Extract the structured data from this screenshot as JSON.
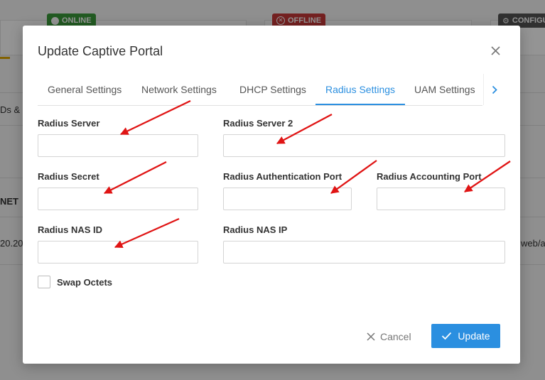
{
  "background": {
    "badges": {
      "online": "ONLINE",
      "offline": "OFFLINE",
      "config": "CONFIGU"
    },
    "fragments": {
      "left_tab": "Ds & N",
      "column_net": "NET",
      "row_ip": "20.20",
      "row_path": "web/ap"
    }
  },
  "modal": {
    "title": "Update Captive Portal",
    "tabs": [
      {
        "label": "General Settings"
      },
      {
        "label": "Network Settings"
      },
      {
        "label": "DHCP Settings"
      },
      {
        "label": "Radius Settings"
      },
      {
        "label": "UAM Settings"
      }
    ],
    "fields": {
      "radius_server": {
        "label": "Radius Server",
        "value": ""
      },
      "radius_server_2": {
        "label": "Radius Server 2",
        "value": ""
      },
      "radius_secret": {
        "label": "Radius Secret",
        "value": ""
      },
      "radius_auth_port": {
        "label": "Radius Authentication Port",
        "value": ""
      },
      "radius_acct_port": {
        "label": "Radius Accounting Port",
        "value": ""
      },
      "radius_nas_id": {
        "label": "Radius NAS ID",
        "value": ""
      },
      "radius_nas_ip": {
        "label": "Radius NAS IP",
        "value": ""
      }
    },
    "swap_octets": {
      "label": "Swap Octets",
      "checked": false
    },
    "buttons": {
      "cancel": "Cancel",
      "update": "Update"
    }
  },
  "colors": {
    "accent": "#2b8fe0",
    "annotation": "#e01414"
  },
  "icons": {
    "close": "close-icon",
    "next": "chevron-right-icon",
    "cancel": "x-icon",
    "update": "check-icon"
  }
}
